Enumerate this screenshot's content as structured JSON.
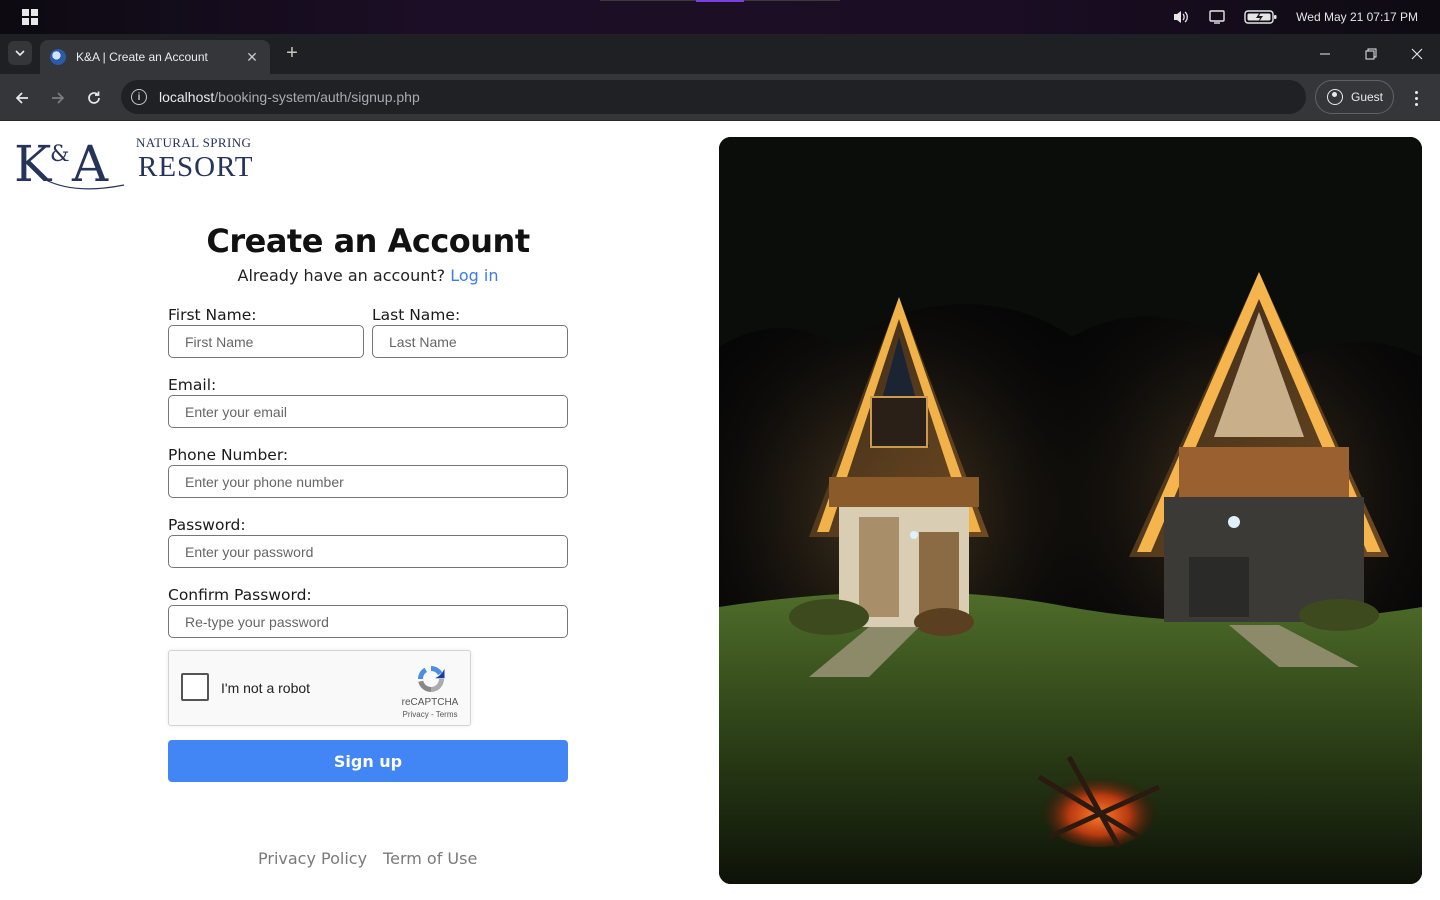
{
  "os": {
    "datetime": "Wed May 21  07:17 PM",
    "icons": [
      "windows-start-icon",
      "volume-icon",
      "display-icon",
      "battery-charging-icon"
    ]
  },
  "browser": {
    "tab_title": "K&A | Create an Account",
    "tab_close": "✕",
    "new_tab": "+",
    "url_host": "localhost",
    "url_path": "/booking-system/auth/signup.php",
    "profile_label": "Guest",
    "window_controls": {
      "minimize": "—",
      "restore": "❐",
      "close": "✕"
    }
  },
  "logo": {
    "mark": "K&A",
    "tagline_top": "Natural Spring",
    "tagline_main": "RESORT"
  },
  "form": {
    "title": "Create an Account",
    "login_prompt": "Already have an account?",
    "login_link": "Log in",
    "first_name": {
      "label": "First Name:",
      "placeholder": "First Name",
      "value": ""
    },
    "last_name": {
      "label": "Last Name:",
      "placeholder": "Last Name",
      "value": ""
    },
    "email": {
      "label": "Email:",
      "placeholder": "Enter your email",
      "value": ""
    },
    "phone": {
      "label": "Phone Number:",
      "placeholder": "Enter your phone number",
      "value": ""
    },
    "password": {
      "label": "Password:",
      "placeholder": "Enter your password",
      "value": ""
    },
    "confirm_password": {
      "label": "Confirm Password:",
      "placeholder": "Re-type your password",
      "value": ""
    },
    "captcha": {
      "label": "I'm not a robot",
      "brand": "reCAPTCHA",
      "links": "Privacy - Terms",
      "checked": false
    },
    "submit_label": "Sign up"
  },
  "footer": {
    "privacy": "Privacy Policy",
    "terms": "Term of Use"
  },
  "colors": {
    "accent": "#4285f4",
    "link": "#3e7be5",
    "logo": "#27345a"
  }
}
